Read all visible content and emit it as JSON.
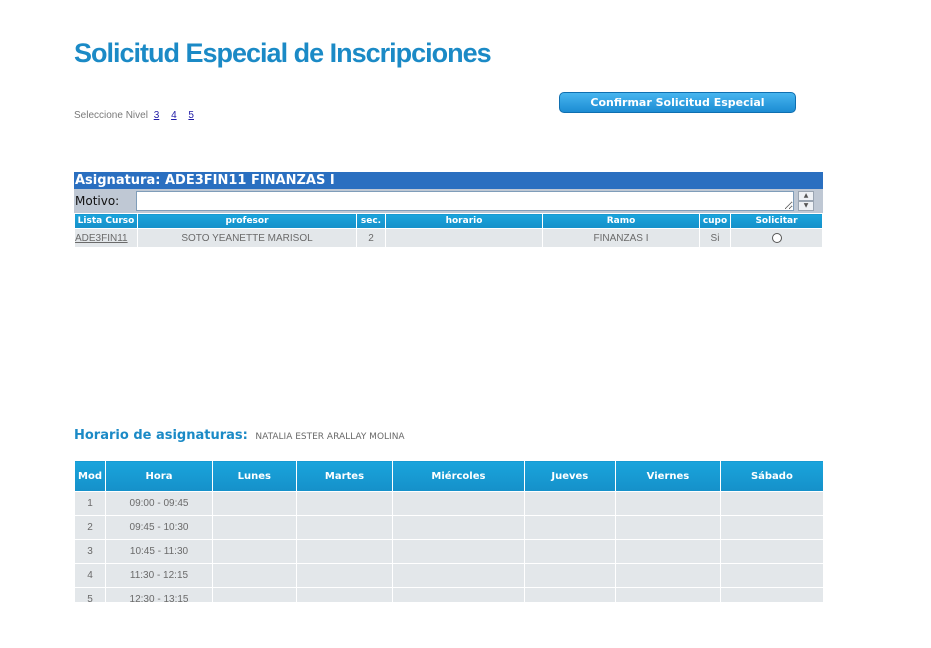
{
  "page": {
    "title": "Solicitud Especial de Inscripciones",
    "level_label": "Seleccione Nivel",
    "levels": [
      "3",
      "4",
      "5"
    ],
    "confirm_button": "Confirmar Solicitud Especial"
  },
  "subject": {
    "header": "Asignatura: ADE3FIN11 FINANZAS I",
    "motivo_label": "Motivo:",
    "motivo_value": "",
    "columns": [
      "Lista Curso",
      "profesor",
      "sec.",
      "horario",
      "Ramo",
      "cupo",
      "Solicitar"
    ],
    "row": {
      "course": "ADE3FIN11",
      "professor": "SOTO YEANETTE MARISOL",
      "section": "2",
      "schedule": "",
      "ramo": "FINANZAS I",
      "cupo": "Si"
    }
  },
  "schedule": {
    "title": "Horario de asignaturas:",
    "student": "NATALIA ESTER ARALLAY MOLINA",
    "columns": [
      "Mod",
      "Hora",
      "Lunes",
      "Martes",
      "Miércoles",
      "Jueves",
      "Viernes",
      "Sábado"
    ],
    "rows": [
      {
        "mod": "1",
        "hora": "09:00 - 09:45"
      },
      {
        "mod": "2",
        "hora": "09:45 - 10:30"
      },
      {
        "mod": "3",
        "hora": "10:45 - 11:30"
      },
      {
        "mod": "4",
        "hora": "11:30 - 12:15"
      },
      {
        "mod": "5",
        "hora": "12:30 - 13:15"
      }
    ]
  }
}
